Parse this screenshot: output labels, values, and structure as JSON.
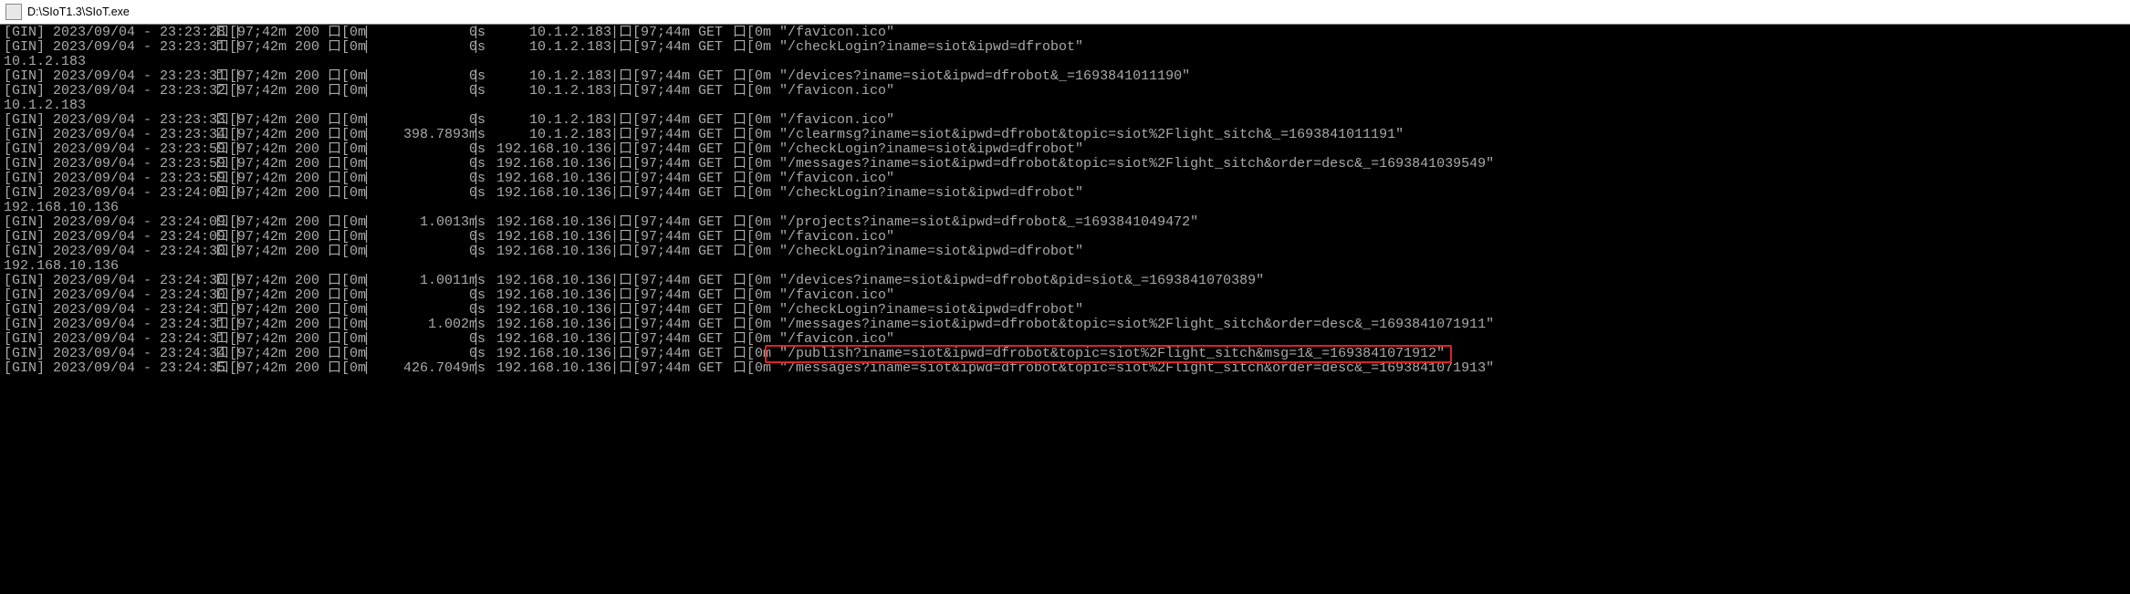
{
  "window": {
    "title": "D:\\SIoT1.3\\SIoT.exe"
  },
  "console": {
    "lines": [
      {
        "t": "row",
        "ts": "2023/09/04 - 23:23:28",
        "code": "200",
        "dur": "0s",
        "ip": "10.1.2.183",
        "m": "GET",
        "p": "/favicon.ico"
      },
      {
        "t": "row",
        "ts": "2023/09/04 - 23:23:31",
        "code": "200",
        "dur": "0s",
        "ip": "10.1.2.183",
        "m": "GET",
        "p": "/checkLogin?iname=siot&ipwd=dfrobot"
      },
      {
        "t": "ip",
        "txt": "10.1.2.183"
      },
      {
        "t": "row",
        "ts": "2023/09/04 - 23:23:31",
        "code": "200",
        "dur": "0s",
        "ip": "10.1.2.183",
        "m": "GET",
        "p": "/devices?iname=siot&ipwd=dfrobot&_=1693841011190"
      },
      {
        "t": "row",
        "ts": "2023/09/04 - 23:23:32",
        "code": "200",
        "dur": "0s",
        "ip": "10.1.2.183",
        "m": "GET",
        "p": "/favicon.ico"
      },
      {
        "t": "ip",
        "txt": "10.1.2.183"
      },
      {
        "t": "row",
        "ts": "2023/09/04 - 23:23:33",
        "code": "200",
        "dur": "0s",
        "ip": "10.1.2.183",
        "m": "GET",
        "p": "/favicon.ico"
      },
      {
        "t": "row",
        "ts": "2023/09/04 - 23:23:34",
        "code": "200",
        "dur": "398.7893ms",
        "ip": "10.1.2.183",
        "m": "GET",
        "p": "/clearmsg?iname=siot&ipwd=dfrobot&topic=siot%2Flight_sitch&_=1693841011191"
      },
      {
        "t": "row",
        "ts": "2023/09/04 - 23:23:59",
        "code": "200",
        "dur": "0s",
        "ip": "192.168.10.136",
        "m": "GET",
        "p": "/checkLogin?iname=siot&ipwd=dfrobot"
      },
      {
        "t": "row",
        "ts": "2023/09/04 - 23:23:59",
        "code": "200",
        "dur": "0s",
        "ip": "192.168.10.136",
        "m": "GET",
        "p": "/messages?iname=siot&ipwd=dfrobot&topic=siot%2Flight_sitch&order=desc&_=1693841039549"
      },
      {
        "t": "row",
        "ts": "2023/09/04 - 23:23:59",
        "code": "200",
        "dur": "0s",
        "ip": "192.168.10.136",
        "m": "GET",
        "p": "/favicon.ico"
      },
      {
        "t": "row",
        "ts": "2023/09/04 - 23:24:09",
        "code": "200",
        "dur": "0s",
        "ip": "192.168.10.136",
        "m": "GET",
        "p": "/checkLogin?iname=siot&ipwd=dfrobot"
      },
      {
        "t": "ip",
        "txt": "192.168.10.136"
      },
      {
        "t": "row",
        "ts": "2023/09/04 - 23:24:09",
        "code": "200",
        "dur": "1.0013ms",
        "ip": "192.168.10.136",
        "m": "GET",
        "p": "/projects?iname=siot&ipwd=dfrobot&_=1693841049472"
      },
      {
        "t": "row",
        "ts": "2023/09/04 - 23:24:09",
        "code": "200",
        "dur": "0s",
        "ip": "192.168.10.136",
        "m": "GET",
        "p": "/favicon.ico"
      },
      {
        "t": "row",
        "ts": "2023/09/04 - 23:24:30",
        "code": "200",
        "dur": "0s",
        "ip": "192.168.10.136",
        "m": "GET",
        "p": "/checkLogin?iname=siot&ipwd=dfrobot"
      },
      {
        "t": "ip",
        "txt": "192.168.10.136"
      },
      {
        "t": "row",
        "ts": "2023/09/04 - 23:24:30",
        "code": "200",
        "dur": "1.0011ms",
        "ip": "192.168.10.136",
        "m": "GET",
        "p": "/devices?iname=siot&ipwd=dfrobot&pid=siot&_=1693841070389"
      },
      {
        "t": "row",
        "ts": "2023/09/04 - 23:24:30",
        "code": "200",
        "dur": "0s",
        "ip": "192.168.10.136",
        "m": "GET",
        "p": "/favicon.ico"
      },
      {
        "t": "row",
        "ts": "2023/09/04 - 23:24:31",
        "code": "200",
        "dur": "0s",
        "ip": "192.168.10.136",
        "m": "GET",
        "p": "/checkLogin?iname=siot&ipwd=dfrobot"
      },
      {
        "t": "row",
        "ts": "2023/09/04 - 23:24:31",
        "code": "200",
        "dur": "1.002ms",
        "ip": "192.168.10.136",
        "m": "GET",
        "p": "/messages?iname=siot&ipwd=dfrobot&topic=siot%2Flight_sitch&order=desc&_=1693841071911"
      },
      {
        "t": "row",
        "ts": "2023/09/04 - 23:24:31",
        "code": "200",
        "dur": "0s",
        "ip": "192.168.10.136",
        "m": "GET",
        "p": "/favicon.ico"
      },
      {
        "t": "row",
        "ts": "2023/09/04 - 23:24:34",
        "code": "200",
        "dur": "0s",
        "ip": "192.168.10.136",
        "m": "GET",
        "p": "/publish?iname=siot&ipwd=dfrobot&topic=siot%2Flight_sitch&msg=1&_=1693841071912",
        "hl": true
      },
      {
        "t": "row",
        "ts": "2023/09/04 - 23:24:35",
        "code": "200",
        "dur": "426.7049ms",
        "ip": "192.168.10.136",
        "m": "GET",
        "p": "/messages?iname=siot&ipwd=dfrobot&topic=siot%2Flight_sitch&order=desc&_=1693841071913"
      }
    ],
    "tokens": {
      "gin": "[GIN] ",
      "box": "口",
      "esc1": "[97;42m ",
      "esc1b": "[97;42m",
      "esc2": "[0m",
      "esc3": "[97;44m ",
      "quote": "\""
    }
  }
}
